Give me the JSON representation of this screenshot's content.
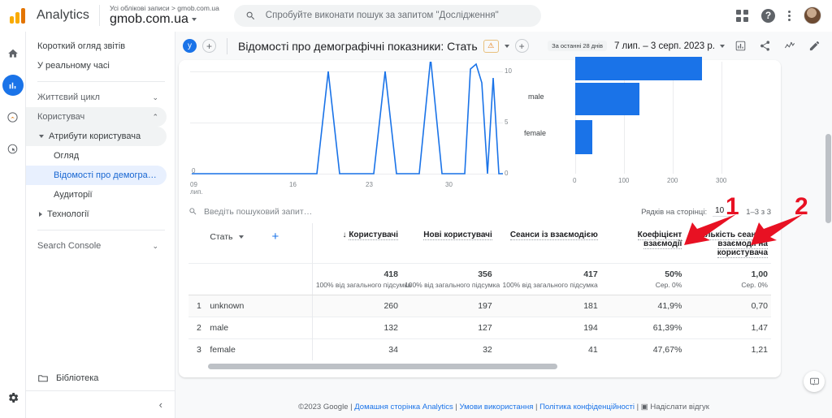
{
  "topbar": {
    "brand": "Analytics",
    "account_breadcrumb": "Усі облікові записи > gmob.com.ua",
    "property_name": "gmob.com.ua",
    "search_placeholder": "Спробуйте виконати пошук за запитом \"Дослідження\"",
    "icons": [
      "search-icon",
      "apps-grid-icon",
      "help-icon",
      "more-options-icon",
      "avatar"
    ]
  },
  "rail": {
    "items": [
      {
        "name": "home",
        "glyph": "⌂",
        "active": false
      },
      {
        "name": "reports",
        "glyph": "▥",
        "active": true
      },
      {
        "name": "explore",
        "glyph": "◴",
        "active": false
      },
      {
        "name": "advertising",
        "glyph": "◎",
        "active": false
      }
    ],
    "settings_glyph": "⚙"
  },
  "sidebar": {
    "items": [
      {
        "label": "Короткий огляд звітів",
        "type": "plain",
        "indent": 0
      },
      {
        "label": "У реальному часі",
        "type": "plain",
        "indent": 0
      },
      {
        "label": "Життєвий цикл",
        "type": "group",
        "indent": 0,
        "chevron": "⌄"
      },
      {
        "label": "Користувач",
        "type": "group-open",
        "indent": 0,
        "chevron": "⌃"
      },
      {
        "label": "Атрибути користувача",
        "type": "subgroup-open",
        "indent": 1
      },
      {
        "label": "Огляд",
        "type": "leaf",
        "indent": 2
      },
      {
        "label": "Відомості про демографіч…",
        "type": "leaf-selected",
        "indent": 2
      },
      {
        "label": "Аудиторії",
        "type": "leaf",
        "indent": 2
      },
      {
        "label": "Технології",
        "type": "subgroup-closed",
        "indent": 1
      },
      {
        "label": "Search Console",
        "type": "group",
        "indent": 0,
        "chevron": "⌄"
      }
    ],
    "library_label": "Бібліотека",
    "library_icon": "folder-icon",
    "collapse_icon": "chevron-left-icon"
  },
  "report": {
    "badge": "у",
    "title": "Відомості про демографічні показники: Стать",
    "warning_icon": "warning-triangle-icon",
    "add_comparison_icon": "add-circle-icon",
    "date_pill": "За останні 28 днів",
    "date_range": "7 лип. – 3 серп. 2023 р.",
    "header_icons": [
      "insights-icon",
      "share-icon",
      "trend-icon",
      "edit-icon"
    ]
  },
  "chart_data": [
    {
      "type": "line",
      "title": "",
      "xlabel": "",
      "ylabel": "",
      "x_tick_labels": [
        "09\nлип.",
        "16",
        "23",
        "30"
      ],
      "y_tick_labels": [
        "0",
        "5",
        "10"
      ],
      "ylim": [
        0,
        12
      ],
      "grid": true,
      "series": [
        {
          "name": "Користувачі",
          "color": "#1a73e8",
          "values": [
            0,
            0,
            0,
            0,
            0,
            0,
            0,
            0,
            10,
            0,
            0,
            0,
            0,
            10,
            0,
            0,
            11.5,
            0,
            0,
            10,
            11.5,
            9.5,
            0,
            9,
            0,
            0
          ]
        }
      ]
    },
    {
      "type": "bar",
      "orientation": "horizontal",
      "title": "",
      "categories": [
        "unknown",
        "male",
        "female"
      ],
      "values": [
        260,
        132,
        34
      ],
      "x_tick_labels": [
        "0",
        "100",
        "200",
        "300"
      ],
      "xlim": [
        0,
        320
      ],
      "color": "#1a73e8",
      "visible_category_labels": [
        "male",
        "female"
      ]
    }
  ],
  "table": {
    "search_placeholder": "Введіть пошуковий запит…",
    "search_icon": "search-icon",
    "rows_per_page_label": "Рядків на сторінці:",
    "rows_per_page_value": "10",
    "range_label": "1–3 з 3",
    "dimension_header": "Стать",
    "add_dimension_icon": "plus-icon",
    "columns": [
      {
        "label": "Користувачі",
        "sorted": true,
        "sort_icon": "↓"
      },
      {
        "label": "Нові користувачі",
        "sorted": false
      },
      {
        "label": "Сеанси із взаємодією",
        "sorted": false
      },
      {
        "label": "Коефіцієнт взаємодії",
        "sorted": false
      },
      {
        "label": "Кількість сеансів взаємодії на користувача",
        "sorted": false
      }
    ],
    "totals": [
      {
        "value": "418",
        "sub": "100% від загального підсумка"
      },
      {
        "value": "356",
        "sub": "100% від загального підсумка"
      },
      {
        "value": "417",
        "sub": "100% від загального підсумка"
      },
      {
        "value": "50%",
        "sub": "Сер. 0%"
      },
      {
        "value": "1,00",
        "sub": "Сер. 0%"
      }
    ],
    "rows": [
      {
        "index": "1",
        "dimension": "unknown",
        "cells": [
          "260",
          "197",
          "181",
          "41,9%",
          "0,70"
        ]
      },
      {
        "index": "2",
        "dimension": "male",
        "cells": [
          "132",
          "127",
          "194",
          "61,39%",
          "1,47"
        ]
      },
      {
        "index": "3",
        "dimension": "female",
        "cells": [
          "34",
          "32",
          "41",
          "47,67%",
          "1,21"
        ]
      }
    ]
  },
  "annotations": [
    {
      "label": "1",
      "target": "engagement-rate-column-header"
    },
    {
      "label": "2",
      "target": "engaged-sessions-per-user-column-header"
    }
  ],
  "footer": {
    "copyright": "©2023 Google",
    "links": [
      "Домашня сторінка Analytics",
      "Умови використання",
      "Політика конфіденційності"
    ],
    "feedback_label": "Надіслати відгук",
    "feedback_icon": "feedback-icon",
    "separator": "|"
  },
  "feedback_button_icon": "feedback-float-icon",
  "colors": {
    "accent": "#1a73e8",
    "brand_orange": "#e37400",
    "annotation_red": "#e81123"
  }
}
